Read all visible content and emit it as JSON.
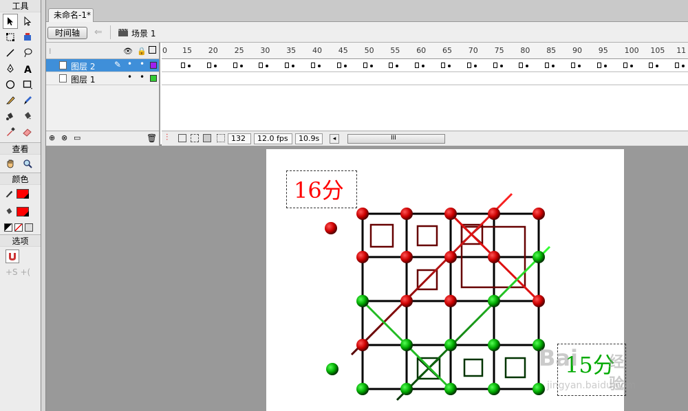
{
  "tools_panel": {
    "title": "工具",
    "view_title": "查看",
    "color_title": "颜色",
    "options_title": "选项",
    "stroke_color": "#ff0000",
    "fill_color": "#ff0000"
  },
  "document": {
    "tab_label": "未命名-1*",
    "timeline_button": "时间轴",
    "scene_label": "场景 1"
  },
  "timeline": {
    "ruler_numbers": [
      "0",
      "15",
      "20",
      "25",
      "30",
      "35",
      "40",
      "45",
      "50",
      "55",
      "60",
      "65",
      "70",
      "75",
      "80",
      "85",
      "90",
      "95",
      "100",
      "105",
      "11"
    ],
    "layers": [
      {
        "name": "图层 2",
        "color": "#a020f0",
        "active": true
      },
      {
        "name": "图层 1",
        "color": "#33cc33",
        "active": false
      }
    ],
    "current_frame": "132",
    "fps": "12.0 fps",
    "elapsed": "10.9s",
    "scroll_glyph": "III"
  },
  "stage": {
    "red_score": "16分",
    "green_score": "15分",
    "red_color": "#ff0000",
    "green_color": "#00aa00",
    "watermark_main": "Bai",
    "watermark_suffix": "经验",
    "watermark_url": "jingyan.baidu.com"
  }
}
